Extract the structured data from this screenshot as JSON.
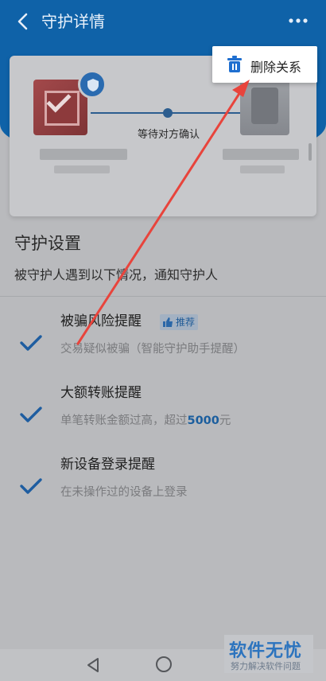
{
  "header": {
    "title": "守护详情"
  },
  "card": {
    "status_text": "等待对方确认"
  },
  "popup": {
    "delete_label": "删除关系"
  },
  "settings": {
    "title": "守护设置",
    "subtitle": "被守护人遇到以下情况，通知守护人",
    "items": [
      {
        "title": "被骗风险提醒",
        "badge": "推荐",
        "desc": "交易疑似被骗（智能守护助手提醒）"
      },
      {
        "title": "大额转账提醒",
        "desc_prefix": "单笔转账金额过高，超过",
        "desc_amount": "5000",
        "desc_suffix": "元"
      },
      {
        "title": "新设备登录提醒",
        "desc": "在未操作过的设备上登录"
      }
    ]
  },
  "watermark": {
    "main": "软件无忧",
    "sub": "努力解决软件问题"
  },
  "colors": {
    "header_blue": "#0f62a8",
    "check_blue": "#1e5da0",
    "arrow_red": "#e8443c"
  }
}
